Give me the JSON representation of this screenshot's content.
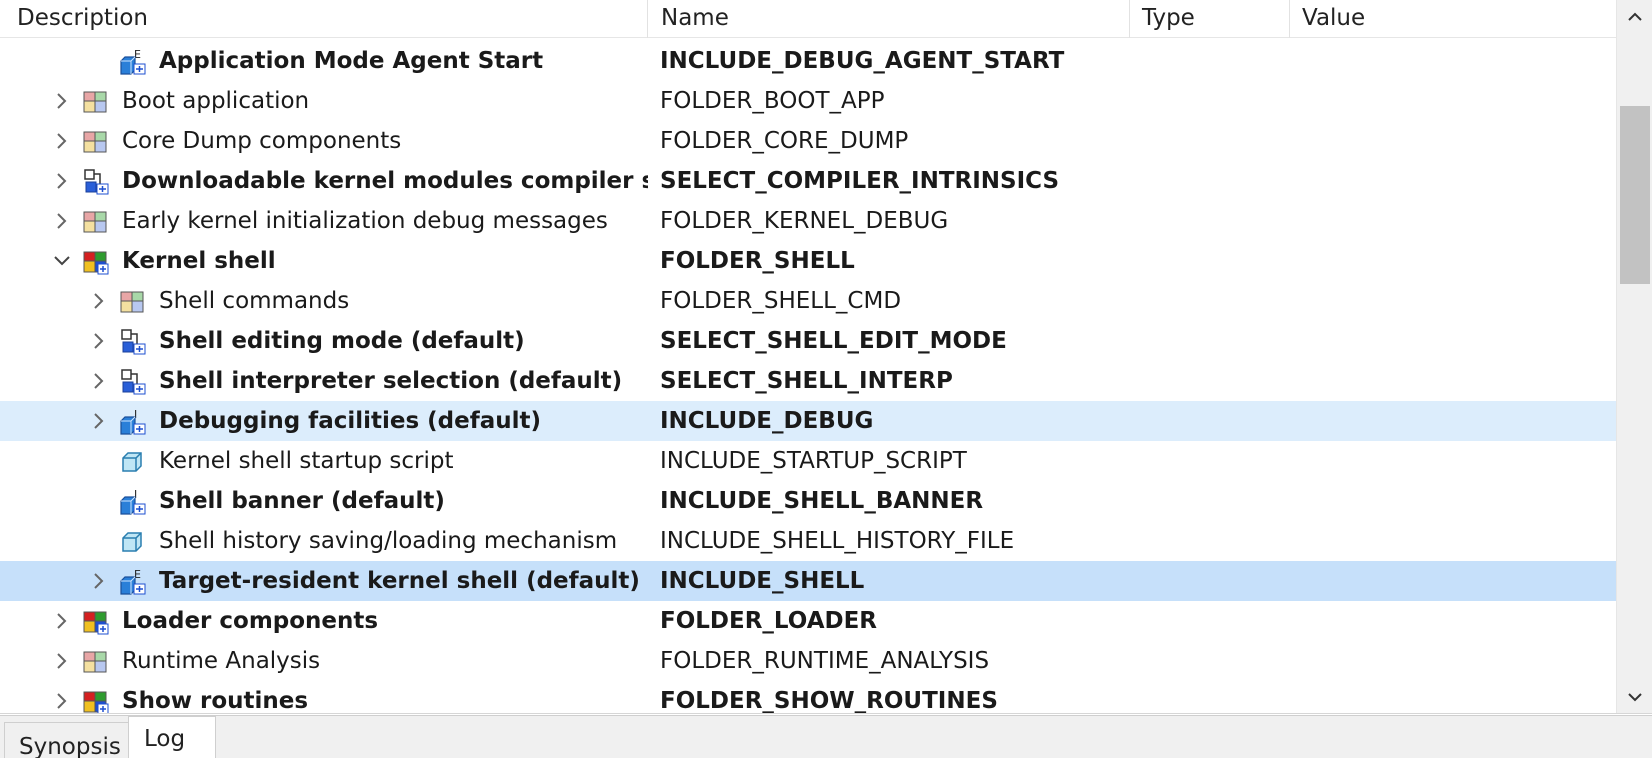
{
  "columns": {
    "description": "Description",
    "name": "Name",
    "type": "Type",
    "value": "Value"
  },
  "rows": [
    {
      "desc": "Application Mode Agent Start",
      "name": "INCLUDE_DEBUG_AGENT_START",
      "icon": "component-E-icon",
      "expander": "none"
    },
    {
      "desc": "Boot application",
      "name": "FOLDER_BOOT_APP",
      "icon": "folder-icon",
      "expander": "collapsed"
    },
    {
      "desc": "Core Dump components",
      "name": "FOLDER_CORE_DUMP",
      "icon": "folder-icon",
      "expander": "collapsed"
    },
    {
      "desc": "Downloadable kernel modules compiler support",
      "name": "SELECT_COMPILER_INTRINSICS",
      "icon": "selection-icon",
      "expander": "collapsed"
    },
    {
      "desc": "Early kernel initialization debug messages",
      "name": "FOLDER_KERNEL_DEBUG",
      "icon": "folder-icon",
      "expander": "collapsed"
    },
    {
      "desc": "Kernel shell",
      "name": "FOLDER_SHELL",
      "icon": "folder-included-icon",
      "expander": "expanded"
    },
    {
      "desc": "Shell commands",
      "name": "FOLDER_SHELL_CMD",
      "icon": "folder-icon",
      "expander": "collapsed"
    },
    {
      "desc": "Shell editing mode (default)",
      "name": "SELECT_SHELL_EDIT_MODE",
      "icon": "selection-icon",
      "expander": "collapsed"
    },
    {
      "desc": "Shell interpreter selection (default)",
      "name": "SELECT_SHELL_INTERP",
      "icon": "selection-icon",
      "expander": "collapsed"
    },
    {
      "desc": "Debugging facilities (default)",
      "name": "INCLUDE_DEBUG",
      "icon": "component-I-icon",
      "expander": "collapsed"
    },
    {
      "desc": "Kernel shell startup script",
      "name": "INCLUDE_STARTUP_SCRIPT",
      "icon": "component-icon",
      "expander": "none"
    },
    {
      "desc": "Shell banner (default)",
      "name": "INCLUDE_SHELL_BANNER",
      "icon": "component-I-icon",
      "expander": "none"
    },
    {
      "desc": "Shell history saving/loading mechanism",
      "name": "INCLUDE_SHELL_HISTORY_FILE",
      "icon": "component-icon",
      "expander": "none"
    },
    {
      "desc": "Target-resident kernel shell (default)",
      "name": "INCLUDE_SHELL",
      "icon": "component-E-icon",
      "expander": "collapsed"
    },
    {
      "desc": "Loader components",
      "name": "FOLDER_LOADER",
      "icon": "folder-included-icon",
      "expander": "collapsed"
    },
    {
      "desc": "Runtime Analysis",
      "name": "FOLDER_RUNTIME_ANALYSIS",
      "icon": "folder-icon",
      "expander": "collapsed"
    },
    {
      "desc": "Show routines",
      "name": "FOLDER_SHOW_ROUTINES",
      "icon": "folder-included-icon",
      "expander": "collapsed"
    }
  ],
  "tabs": {
    "synopsis": "Synopsis",
    "log": "Log"
  },
  "colors": {
    "selected_row": "#c6e0fa",
    "hover_row": "#dcedfc"
  }
}
